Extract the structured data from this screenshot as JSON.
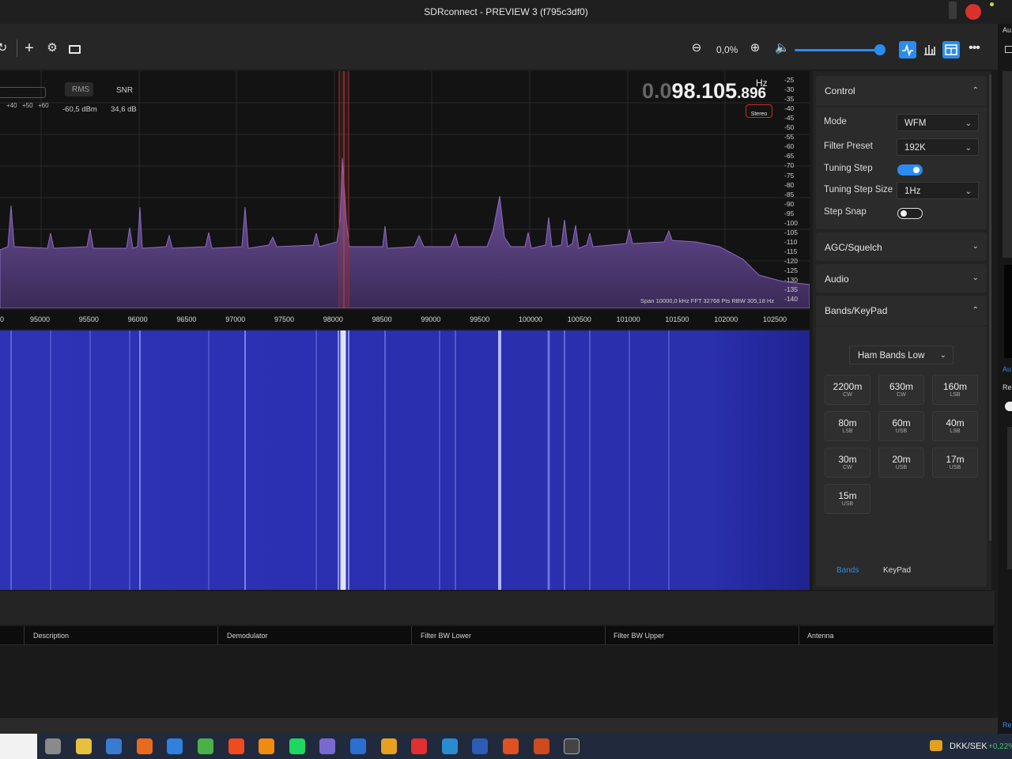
{
  "window": {
    "title": "SDRconnect - PREVIEW 3 (f795c3df0)"
  },
  "toolbar": {
    "zoom_value": "0,0%"
  },
  "spectrum": {
    "rms_label": "RMS",
    "snr_label": "SNR",
    "rms_value": "-60,5 dBm",
    "snr_value": "34,6 dB",
    "scale_ticks": [
      "+40",
      "+50",
      "+60"
    ],
    "freq_prefix": "0.0",
    "freq_main": "98.105",
    "freq_fine": ".896",
    "freq_unit": "Hz",
    "stereo_badge": "Stereo",
    "info": "Span 10000,0 kHz FFT 32768 Pts  RBW 305,18 Hz",
    "db_axis": [
      "-25",
      "-30",
      "-35",
      "-40",
      "-45",
      "-50",
      "-55",
      "-60",
      "-65",
      "-70",
      "-75",
      "-80",
      "-85",
      "-90",
      "-95",
      "-100",
      "-105",
      "-110",
      "-115",
      "-120",
      "-125",
      "-130",
      "-135",
      "-140"
    ],
    "freq_axis": [
      "0",
      "95000",
      "95500",
      "96000",
      "96500",
      "97000",
      "97500",
      "98000",
      "98500",
      "99000",
      "99500",
      "100000",
      "100500",
      "101000",
      "101500",
      "102000",
      "102500"
    ]
  },
  "panel": {
    "control": {
      "title": "Control",
      "mode_label": "Mode",
      "mode_value": "WFM",
      "filter_label": "Filter Preset",
      "filter_value": "192K",
      "tuning_step_label": "Tuning Step",
      "tuning_step_on": true,
      "tuning_size_label": "Tuning Step Size",
      "tuning_size_value": "1Hz",
      "step_snap_label": "Step Snap",
      "step_snap_on": false
    },
    "agc_title": "AGC/Squelch",
    "audio_title": "Audio",
    "bands": {
      "title": "Bands/KeyPad",
      "group": "Ham Bands Low",
      "buttons": [
        {
          "name": "2200m",
          "mode": "CW"
        },
        {
          "name": "630m",
          "mode": "CW"
        },
        {
          "name": "160m",
          "mode": "LSB"
        },
        {
          "name": "80m",
          "mode": "LSB"
        },
        {
          "name": "60m",
          "mode": "USB"
        },
        {
          "name": "40m",
          "mode": "LSB"
        },
        {
          "name": "30m",
          "mode": "CW"
        },
        {
          "name": "20m",
          "mode": "USB"
        },
        {
          "name": "17m",
          "mode": "USB"
        },
        {
          "name": "15m",
          "mode": "USB"
        }
      ],
      "tab_bands": "Bands",
      "tab_keypad": "KeyPad"
    }
  },
  "table": {
    "columns": [
      "Description",
      "Demodulator",
      "Filter BW Lower",
      "Filter BW Upper",
      "Antenna"
    ]
  },
  "edge": {
    "top_text": "Au",
    "mid_text_1": "Au",
    "mid_text_2": "Re",
    "bottom_text": "Re"
  },
  "taskbar": {
    "ticker": "DKK/SEK",
    "ticker_change": "+0,22%"
  },
  "colors": {
    "accent": "#2a8cf0",
    "spectrum_fill": "#6a4f97",
    "waterfall": "#2a2fb0",
    "record": "#d8322c",
    "stereo_border": "#d02a2a"
  }
}
